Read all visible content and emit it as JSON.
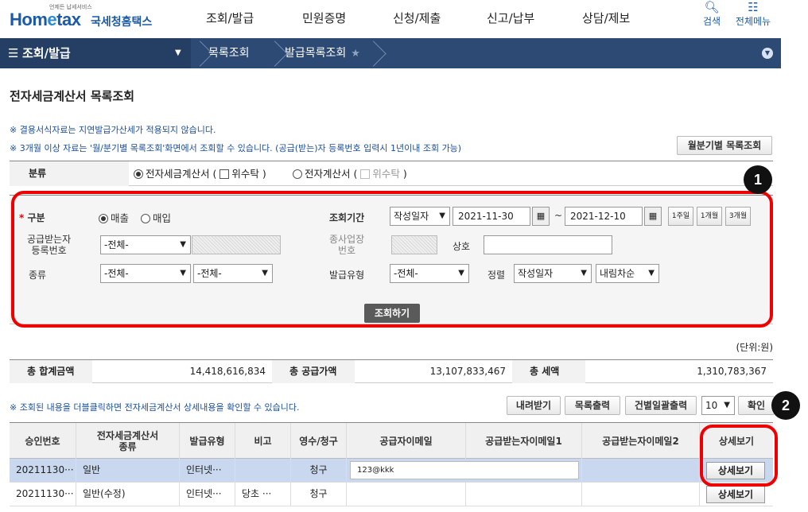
{
  "header": {
    "logo_small": "언제든 납세서비스",
    "logo_home": "Hom",
    "logo_e": "e",
    "logo_tax": "tax",
    "logo_kr": "국세청홈택스",
    "nav": [
      "조회/발급",
      "민원증명",
      "신청/제출",
      "신고/납부",
      "상담/제보"
    ],
    "search": "검색",
    "all_menu": "전체메뉴"
  },
  "breadcrumb": {
    "first": "조회/발급",
    "second": "목록조회",
    "third": "발급목록조회"
  },
  "page_title": "전자세금계산서 목록조회",
  "notes": {
    "n1": "※ 결용서식자료는 지연발급가산세가 적용되지 않습니다.",
    "n2": "※ 3개월 이상 자료는 '월/분기별 목록조회'화면에서 조회할 수 있습니다. (공급(받는)자 등록번호 입력시 1년이내 조회 가능)"
  },
  "monthly_button": "월분기별 목록조회",
  "classification": {
    "label": "분류",
    "opt1": "전자세금계산서",
    "opt1_sub": "위수탁",
    "opt2": "전자계산서",
    "opt2_sub": "위수탁"
  },
  "form": {
    "type_label": "구분",
    "sales": "매출",
    "purchase": "매입",
    "period_label": "조회기간",
    "period_type": "작성일자",
    "date_from": "2021-11-30",
    "tilde": "~",
    "date_to": "2021-12-10",
    "p1": "1주일",
    "p2": "1개월",
    "p3": "3개월",
    "receiver_label_1": "공급받는자",
    "receiver_label_2": "등록번호",
    "receiver_sel": "-전체-",
    "sub_label_1": "종사업장",
    "sub_label_2": "번호",
    "company_label": "상호",
    "kind_label": "종류",
    "kind_sel1": "-전체-",
    "kind_sel2": "-전체-",
    "issue_type_label": "발급유형",
    "issue_type_sel": "-전체-",
    "sort_label": "정렬",
    "sort_by": "작성일자",
    "sort_order": "내림차순",
    "search_button": "조회하기"
  },
  "unit": "(단위:원)",
  "totals": {
    "total_label": "총 합계금액",
    "total_value": "14,418,616,834",
    "supply_label": "총 공급가액",
    "supply_value": "13,107,833,467",
    "tax_label": "총 세액",
    "tax_value": "1,310,783,367"
  },
  "list_note": "※ 조회된 내용을 더블클릭하면 전자세금계산서 상세내용을 확인할 수 있습니다.",
  "list_buttons": {
    "download": "내려받기",
    "print": "목록출력",
    "bulk_print": "건별일괄출력",
    "page_size": "10",
    "confirm": "확인"
  },
  "markers": {
    "m1": "1",
    "m2": "2"
  },
  "table": {
    "headers": [
      "승인번호",
      "전자세금계산서 종류",
      "발급유형",
      "비고",
      "영수/청구",
      "공급자이메일",
      "공급받는자이메일1",
      "공급받는자이메일2",
      "상세보기"
    ],
    "rows": [
      {
        "approval": "20211130···",
        "kind": "일반",
        "issue": "인터넷···",
        "note": "",
        "receipt": "청구",
        "sup_email": "123@kkk",
        "rec_email1": "",
        "rec_email2": "",
        "detail": "상세보기"
      },
      {
        "approval": "20211130···",
        "kind": "일반(수정)",
        "issue": "인터넷···",
        "note": "당초 ···",
        "receipt": "청구",
        "sup_email": "",
        "rec_email1": "",
        "rec_email2": "",
        "detail": "상세보기"
      }
    ]
  },
  "colors": {
    "nav_bar": "#2d4a74",
    "highlight_row": "#c9d8ee",
    "annotation_red": "#e00000"
  }
}
